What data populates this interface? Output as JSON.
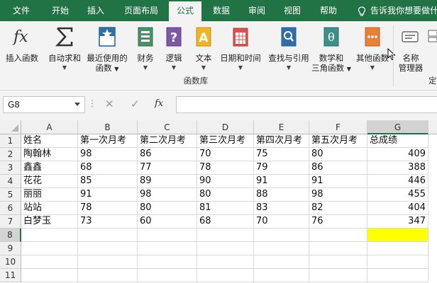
{
  "tabs": [
    {
      "label": "文件"
    },
    {
      "label": "开始"
    },
    {
      "label": "插入"
    },
    {
      "label": "页面布局"
    },
    {
      "label": "公式",
      "active": true
    },
    {
      "label": "数据"
    },
    {
      "label": "审阅"
    },
    {
      "label": "视图"
    },
    {
      "label": "帮助"
    }
  ],
  "tell_me": "告诉我你想要做什",
  "ribbon": {
    "buttons": [
      {
        "label": "插入函数",
        "icon": "insert-function-icon"
      },
      {
        "label": "自动求和",
        "icon": "autosum-icon",
        "dropdown": true
      },
      {
        "label": "最近使用的",
        "label2": "函数",
        "icon": "recent-functions-icon"
      },
      {
        "label": "财务",
        "icon": "financial-icon",
        "dropdown": true
      },
      {
        "label": "逻辑",
        "icon": "logical-icon",
        "dropdown": true
      },
      {
        "label": "文本",
        "icon": "text-icon",
        "dropdown": true
      },
      {
        "label": "日期和时间",
        "icon": "date-time-icon",
        "dropdown": true
      },
      {
        "label": "查找与引用",
        "icon": "lookup-reference-icon",
        "dropdown": true
      },
      {
        "label": "数学和",
        "label2": "三角函数",
        "icon": "math-trig-icon"
      },
      {
        "label": "其他函数",
        "icon": "more-functions-icon",
        "dropdown": true
      },
      {
        "label": "名称",
        "label2": "管理器",
        "icon": "name-manager-icon"
      }
    ],
    "group_label": "函数库",
    "truncated_group_label": "定"
  },
  "formula_bar": {
    "name_box": "G8",
    "separator": "⋮",
    "cancel": "✕",
    "enter": "✓",
    "fx": "fx",
    "formula": ""
  },
  "sheet": {
    "columns": [
      "A",
      "B",
      "C",
      "D",
      "E",
      "F",
      "G"
    ],
    "rows": [
      "1",
      "2",
      "3",
      "4",
      "5",
      "6",
      "7",
      "8",
      "9",
      "10",
      "11"
    ],
    "cells": [
      [
        "姓名",
        "第一次月考",
        "第二次月考",
        "第三次月考",
        "第四次月考",
        "第五次月考",
        "总成绩"
      ],
      [
        "陶翰林",
        "98",
        "86",
        "70",
        "75",
        "80",
        "409"
      ],
      [
        "鑫鑫",
        "68",
        "77",
        "78",
        "79",
        "86",
        "388"
      ],
      [
        "花花",
        "85",
        "89",
        "90",
        "91",
        "91",
        "446"
      ],
      [
        "丽丽",
        "91",
        "98",
        "80",
        "88",
        "98",
        "455"
      ],
      [
        "站站",
        "78",
        "80",
        "81",
        "83",
        "82",
        "404"
      ],
      [
        "白梦玉",
        "73",
        "60",
        "68",
        "70",
        "76",
        "347"
      ]
    ],
    "selected_cell": "G8",
    "highlight_color": "#ffff00"
  },
  "colors": {
    "accent": "#217346",
    "ribbon_bg": "#f3f3f3"
  }
}
